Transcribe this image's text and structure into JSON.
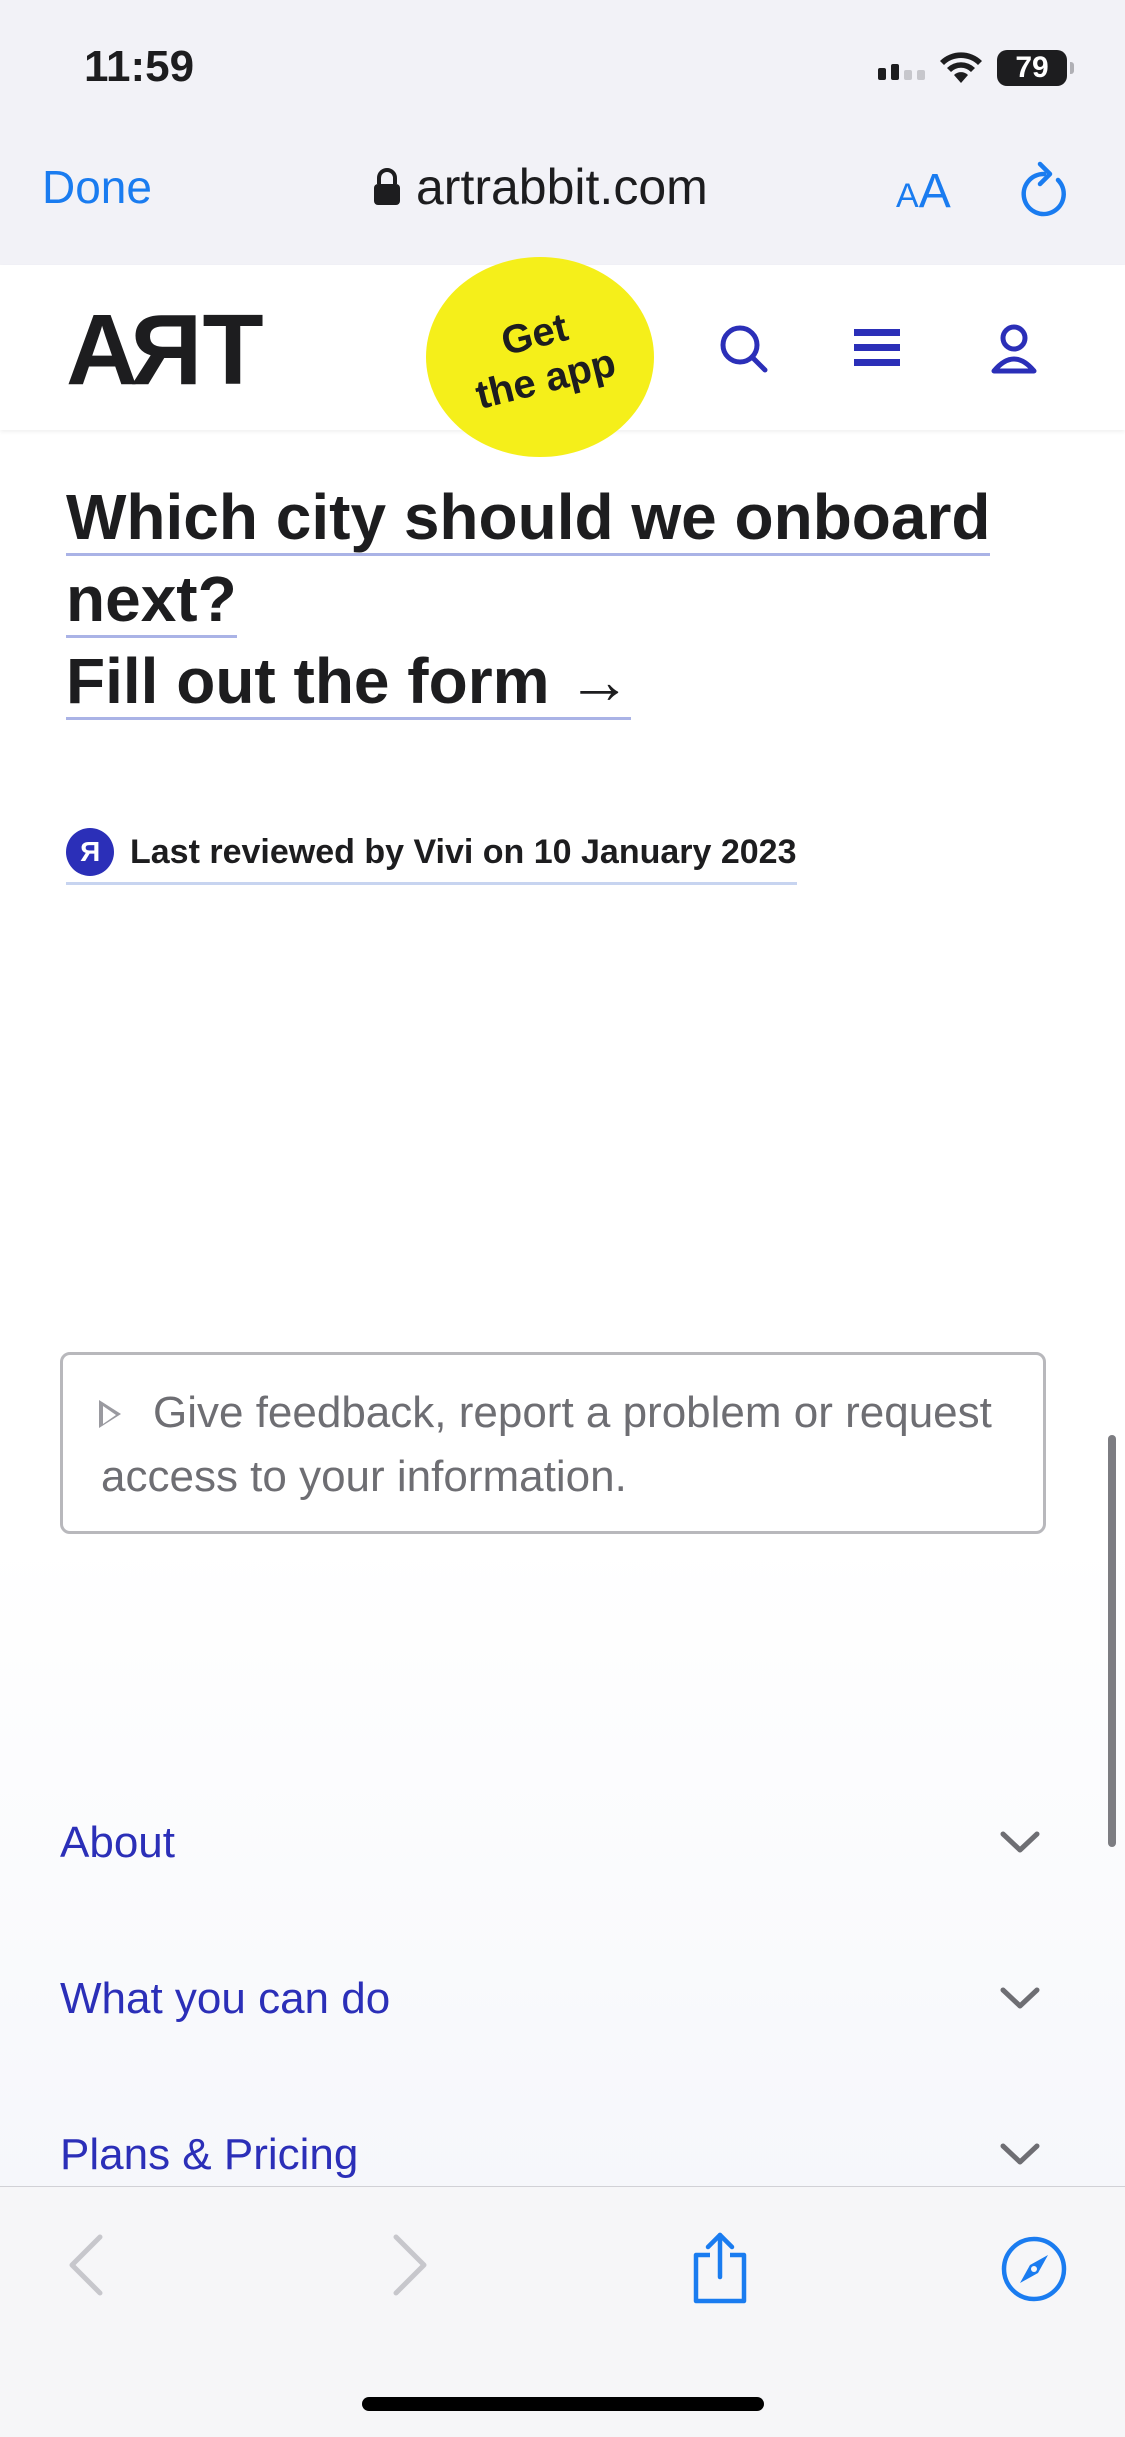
{
  "status_bar": {
    "time": "11:59",
    "battery": "79"
  },
  "browser": {
    "done_label": "Done",
    "url": "artrabbit.com",
    "text_size_small": "A",
    "text_size_large": "A"
  },
  "site_header": {
    "logo_left": "A",
    "logo_r": "R",
    "logo_right": "T",
    "get_app": "Get\nthe app"
  },
  "content": {
    "headline_line1": "Which city should we onboard next?",
    "headline_line2": "Fill out the form →",
    "reviewed_badge": "R",
    "reviewed_text": "Last reviewed by Vivi on 10 January 2023",
    "feedback_text": "Give feedback, report a problem or request access to your information."
  },
  "footer": {
    "items": [
      {
        "label": "About"
      },
      {
        "label": "What you can do"
      },
      {
        "label": "Plans & Pricing"
      }
    ]
  },
  "colors": {
    "accent": "#2b2fb8",
    "safari_blue": "#1a7cf0",
    "badge_yellow": "#f5ef1a"
  }
}
